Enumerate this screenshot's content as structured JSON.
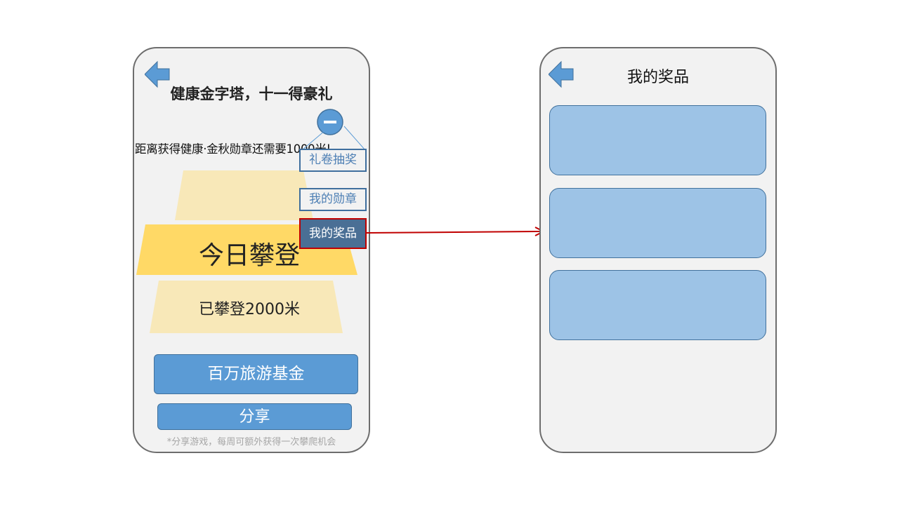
{
  "left_screen": {
    "title": "健康金字塔，十一得豪礼",
    "distance_notice": "距离获得健康·金秋勋章还需要1000米!",
    "menu_toggle_icon": "minus-circle-icon",
    "back_icon": "back-arrow-icon",
    "menu_items": [
      {
        "label": "礼卷抽奖",
        "active": false
      },
      {
        "label": "我的勋章",
        "active": false
      },
      {
        "label": "我的奖品",
        "active": true
      }
    ],
    "pyramid": {
      "today_label": "今日攀登",
      "climbed_label": "已攀登2000米"
    },
    "fund_button": "百万旅游基金",
    "share_button": "分享",
    "footnote": "*分享游戏，每周可额外获得一次攀爬机会"
  },
  "right_screen": {
    "title": "我的奖品",
    "back_icon": "back-arrow-icon",
    "prize_cards": [
      "",
      "",
      ""
    ]
  },
  "colors": {
    "accent_blue": "#5b9bd5",
    "card_blue": "#9dc3e6",
    "pyramid_main": "#ffd966",
    "pyramid_light": "#f8e8b8",
    "highlight_red": "#c00000",
    "dark_blue": "#4a6f95"
  }
}
